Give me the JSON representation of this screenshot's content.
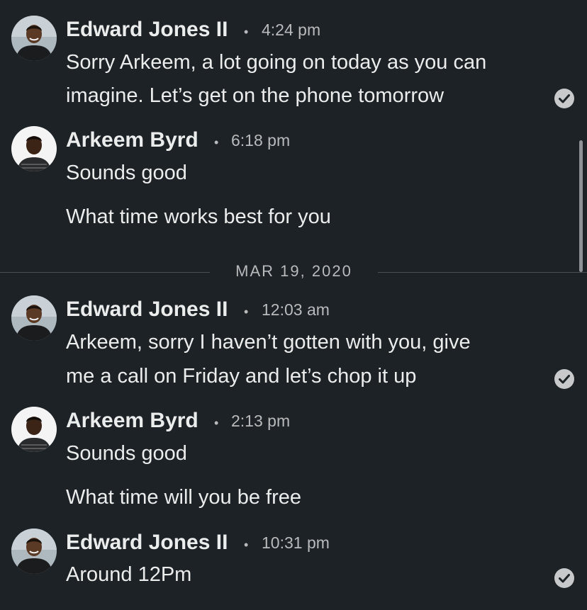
{
  "messages": [
    {
      "sender": "Edward Jones II",
      "time": "4:24 pm",
      "lines": [
        "Sorry Arkeem, a lot going on today as you can",
        "imagine. Let’s get on the phone tomorrow"
      ],
      "seen": true
    },
    {
      "sender": "Arkeem Byrd",
      "time": "6:18 pm",
      "lines": [
        "Sounds good",
        "What time works best for you"
      ],
      "seen": false
    },
    {
      "sender": "Edward Jones II",
      "time": "12:03 am",
      "lines": [
        "Arkeem, sorry I haven’t gotten with you, give",
        "me a call on Friday and let’s chop it up"
      ],
      "seen": true
    },
    {
      "sender": "Arkeem Byrd",
      "time": "2:13 pm",
      "lines": [
        "Sounds good",
        "What time will you be free"
      ],
      "seen": false
    },
    {
      "sender": "Edward Jones II",
      "time": "10:31 pm",
      "lines": [
        "Around 12Pm"
      ],
      "seen": true
    }
  ],
  "date_divider": "MAR 19, 2020",
  "separator": "•",
  "colors": {
    "background": "#1d2226",
    "text_primary": "#ebecec",
    "text_secondary": "#b8babb",
    "seen_check": "#c7c9ca"
  },
  "icons": {
    "seen": "check-circle-icon"
  }
}
